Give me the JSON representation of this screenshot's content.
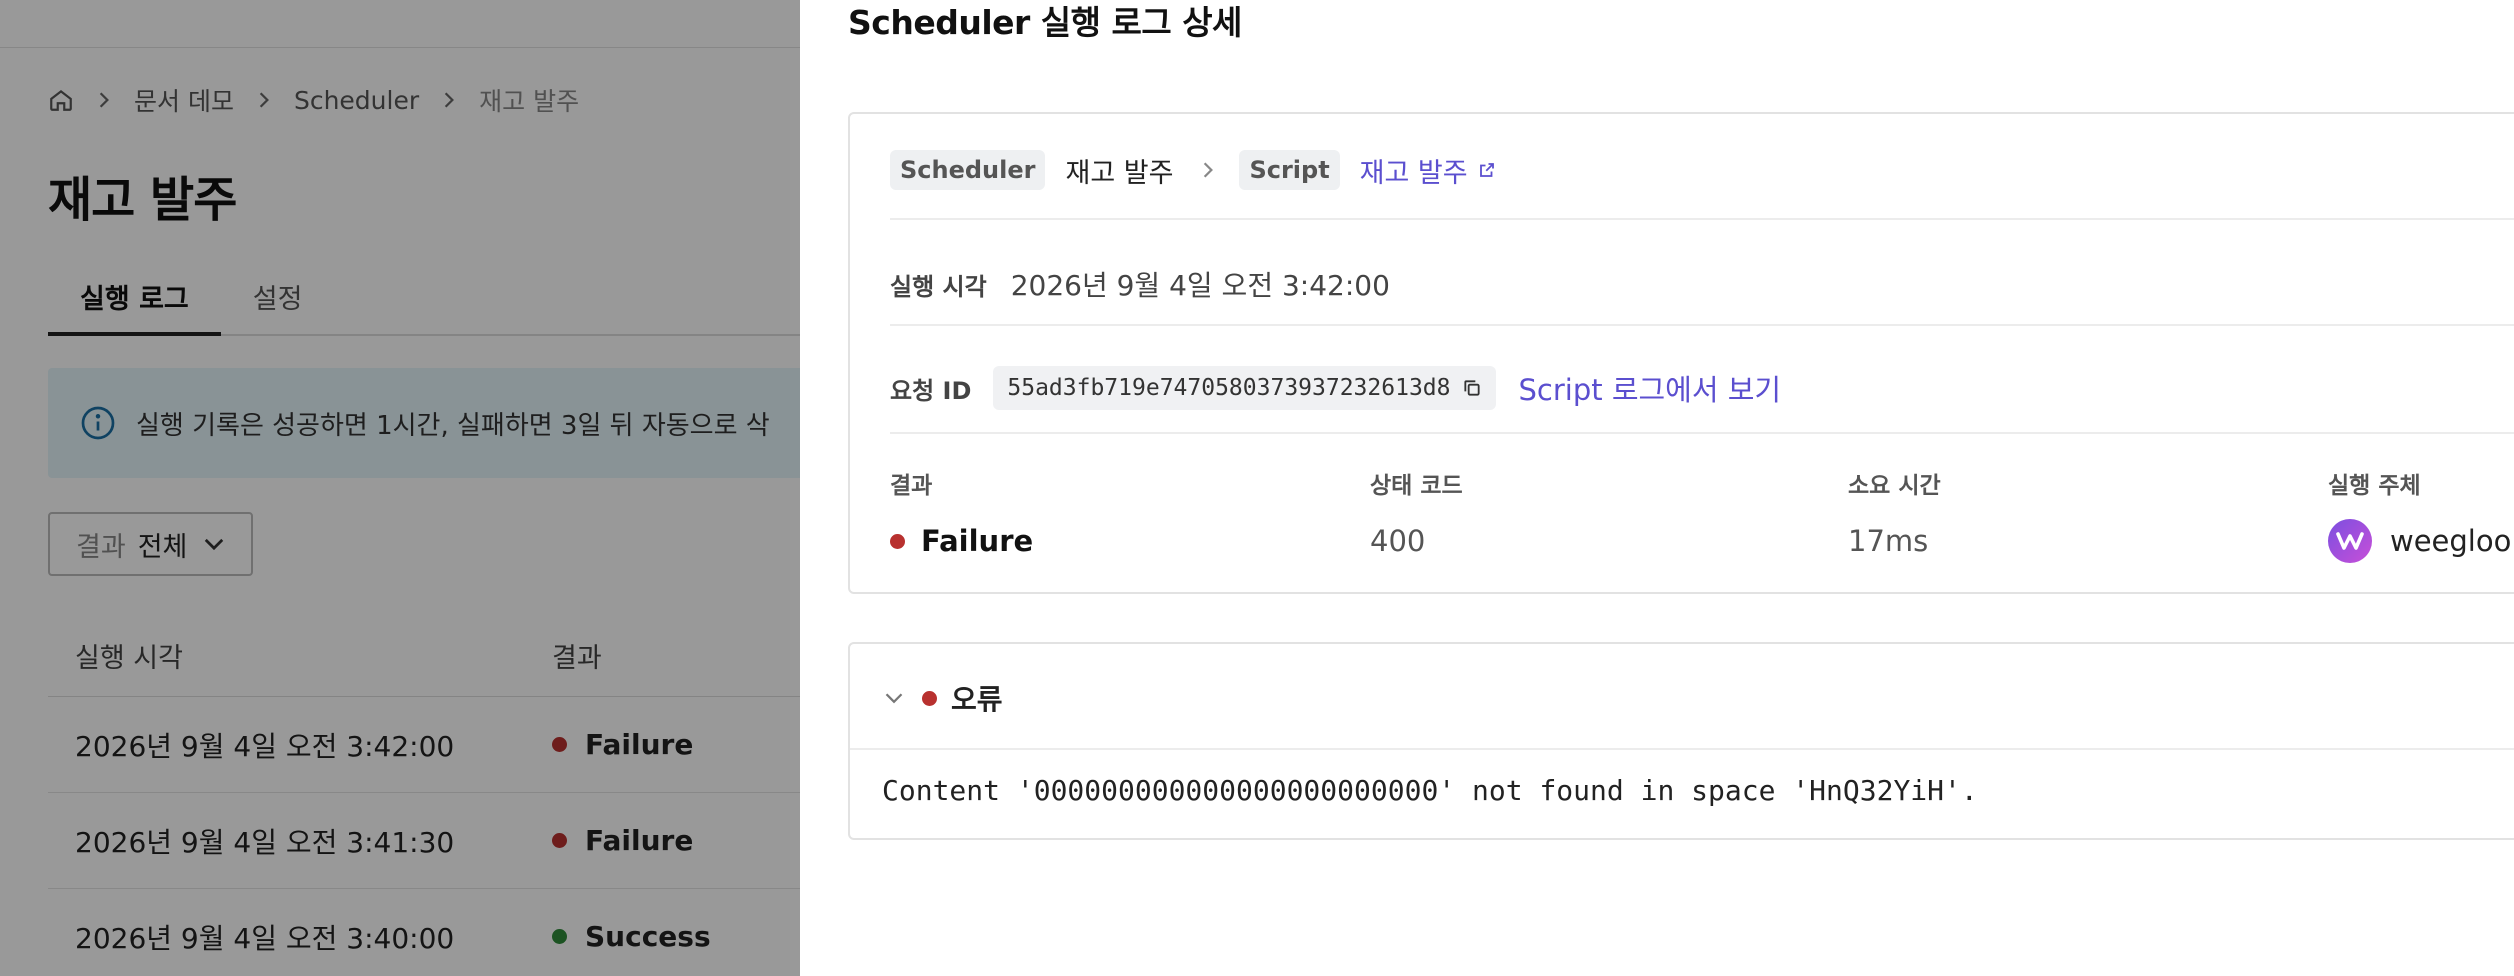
{
  "background": {
    "breadcrumb": [
      "문서 데모",
      "Scheduler",
      "재고 발주"
    ],
    "page_title": "재고 발주",
    "tabs": [
      {
        "label": "실행 로그",
        "active": true
      },
      {
        "label": "설정",
        "active": false
      }
    ],
    "info_banner": "실행 기록은 성공하면 1시간, 실패하면 3일 뒤 자동으로 삭",
    "filter": {
      "label": "결과",
      "value": "전체"
    },
    "table": {
      "headers": [
        "실행 시각",
        "결과"
      ],
      "rows": [
        {
          "time": "2026년 9월 4일 오전 3:42:00",
          "result": "Failure",
          "status": "red"
        },
        {
          "time": "2026년 9월 4일 오전 3:41:30",
          "result": "Failure",
          "status": "red"
        },
        {
          "time": "2026년 9월 4일 오전 3:40:00",
          "result": "Success",
          "status": "green"
        }
      ]
    }
  },
  "drawer": {
    "title": "Scheduler 실행 로그 상세",
    "source": {
      "tag1": "Scheduler",
      "name1": "재고 발주",
      "tag2": "Script",
      "link": "재고 발주"
    },
    "exec_time": {
      "label": "실행 시각",
      "value": "2026년 9월 4일 오전 3:42:00"
    },
    "request": {
      "label": "요청 ID",
      "id": "55ad3fb719e7470580373937232613d8",
      "link": "Script 로그에서 보기"
    },
    "stats": {
      "result": {
        "label": "결과",
        "value": "Failure"
      },
      "status_code": {
        "label": "상태 코드",
        "value": "400"
      },
      "duration": {
        "label": "소요 시간",
        "value": "17ms"
      },
      "actor": {
        "label": "실행 주체",
        "value": "weegloo s"
      }
    },
    "error": {
      "title": "오류",
      "message": "Content '000000000000000000000000' not found in space 'HnQ32YiH'."
    }
  },
  "colors": {
    "accent": "#5b4fcf",
    "failure": "#b8312f",
    "success": "#2f8a3a",
    "info_bg": "#e5f5fb"
  }
}
